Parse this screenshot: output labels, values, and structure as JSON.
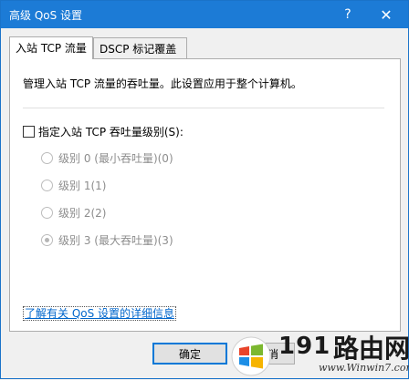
{
  "window": {
    "title": "高级 QoS 设置",
    "help_label": "?",
    "close_label": "✕"
  },
  "tabs": [
    {
      "label": "入站 TCP 流量",
      "active": true
    },
    {
      "label": "DSCP 标记覆盖",
      "active": false
    }
  ],
  "panel": {
    "description": "管理入站 TCP 流量的吞吐量。此设置应用于整个计算机。",
    "checkbox_label": "指定入站 TCP 吞吐量级别(S):",
    "checkbox_checked": false,
    "options": [
      {
        "label": "级别 0 (最小吞吐量)(0)",
        "selected": false
      },
      {
        "label": "级别 1(1)",
        "selected": false
      },
      {
        "label": "级别 2(2)",
        "selected": false
      },
      {
        "label": "级别 3 (最大吞吐量)(3)",
        "selected": true
      }
    ],
    "link": "了解有关 QoS 设置的详细信息"
  },
  "buttons": {
    "ok": "确定",
    "cancel": "取消"
  },
  "watermark": {
    "numbers": "191",
    "chinese": "路由网",
    "site": "www.Winwin7.com"
  }
}
